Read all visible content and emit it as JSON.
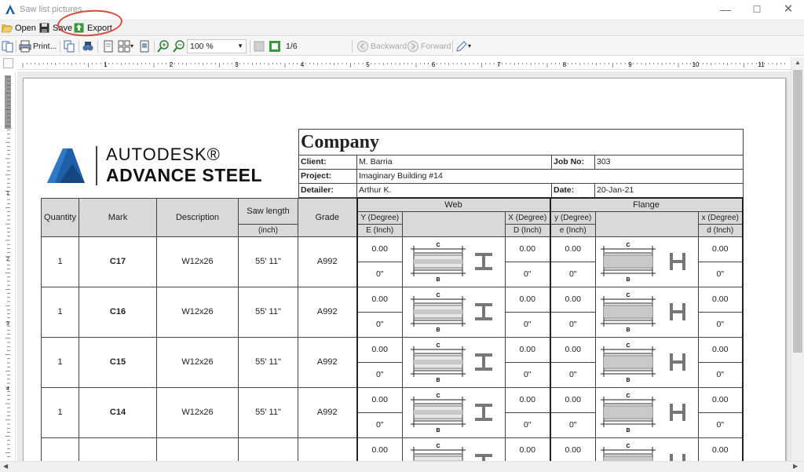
{
  "window": {
    "title": "Saw list pictures"
  },
  "menu": {
    "open": "Open",
    "save": "Save",
    "export": "Export"
  },
  "toolbar": {
    "print": "Print...",
    "zoom": "100 %",
    "page": "1/6",
    "backward": "Backward",
    "forward": "Forward"
  },
  "ruler": {
    "labels": [
      "1",
      "2",
      "3",
      "4",
      "5",
      "6",
      "7",
      "8",
      "9",
      "10",
      "11"
    ]
  },
  "logo": {
    "line1": "AUTODESK®",
    "line2": "ADVANCE STEEL"
  },
  "header": {
    "company": "Company",
    "client_label": "Client:",
    "client": "M. Barria",
    "job_label": "Job No:",
    "job": "303",
    "project_label": "Project:",
    "project": "Imaginary Building #14",
    "detailer_label": "Detailer:",
    "detailer": "Arthur K.",
    "date_label": "Date:",
    "date": "20-Jan-21"
  },
  "table": {
    "columns": {
      "quantity": "Quantity",
      "mark": "Mark",
      "description": "Description",
      "saw_length": "Saw length",
      "saw_unit": "(inch)",
      "grade": "Grade",
      "web": "Web",
      "flange": "Flange",
      "web_y": "Y (Degree)",
      "web_e": "E (Inch)",
      "web_x": "X (Degree)",
      "web_d": "D (Inch)",
      "fl_y": "y (Degree)",
      "fl_e": "e (Inch)",
      "fl_x": "x (Degree)",
      "fl_d": "d (Inch)"
    },
    "rows": [
      {
        "quantity": "1",
        "mark": "C17",
        "description": "W12x26",
        "length": "55' 11\"",
        "grade": "A992",
        "web_y": "0.00",
        "web_e": "0\"",
        "web_x": "0.00",
        "web_d": "0\"",
        "fl_y": "0.00",
        "fl_e": "0\"",
        "fl_x": "0.00",
        "fl_d": "0\""
      },
      {
        "quantity": "1",
        "mark": "C16",
        "description": "W12x26",
        "length": "55' 11\"",
        "grade": "A992",
        "web_y": "0.00",
        "web_e": "0\"",
        "web_x": "0.00",
        "web_d": "0\"",
        "fl_y": "0.00",
        "fl_e": "0\"",
        "fl_x": "0.00",
        "fl_d": "0\""
      },
      {
        "quantity": "1",
        "mark": "C15",
        "description": "W12x26",
        "length": "55' 11\"",
        "grade": "A992",
        "web_y": "0.00",
        "web_e": "0\"",
        "web_x": "0.00",
        "web_d": "0\"",
        "fl_y": "0.00",
        "fl_e": "0\"",
        "fl_x": "0.00",
        "fl_d": "0\""
      },
      {
        "quantity": "1",
        "mark": "C14",
        "description": "W12x26",
        "length": "55' 11\"",
        "grade": "A992",
        "web_y": "0.00",
        "web_e": "0\"",
        "web_x": "0.00",
        "web_d": "0\"",
        "fl_y": "0.00",
        "fl_e": "0\"",
        "fl_x": "0.00",
        "fl_d": "0\""
      },
      {
        "quantity": "",
        "mark": "",
        "description": "",
        "length": "",
        "grade": "",
        "web_y": "0.00",
        "web_e": "",
        "web_x": "0.00",
        "web_d": "",
        "fl_y": "0.00",
        "fl_e": "",
        "fl_x": "0.00",
        "fl_d": ""
      }
    ],
    "figure_labels": {
      "c": "C",
      "b": "B"
    }
  },
  "colors": {
    "highlight": "#d64a3e",
    "logo_blue": "#1f5fa8",
    "header_gray": "#d9d9d9"
  }
}
